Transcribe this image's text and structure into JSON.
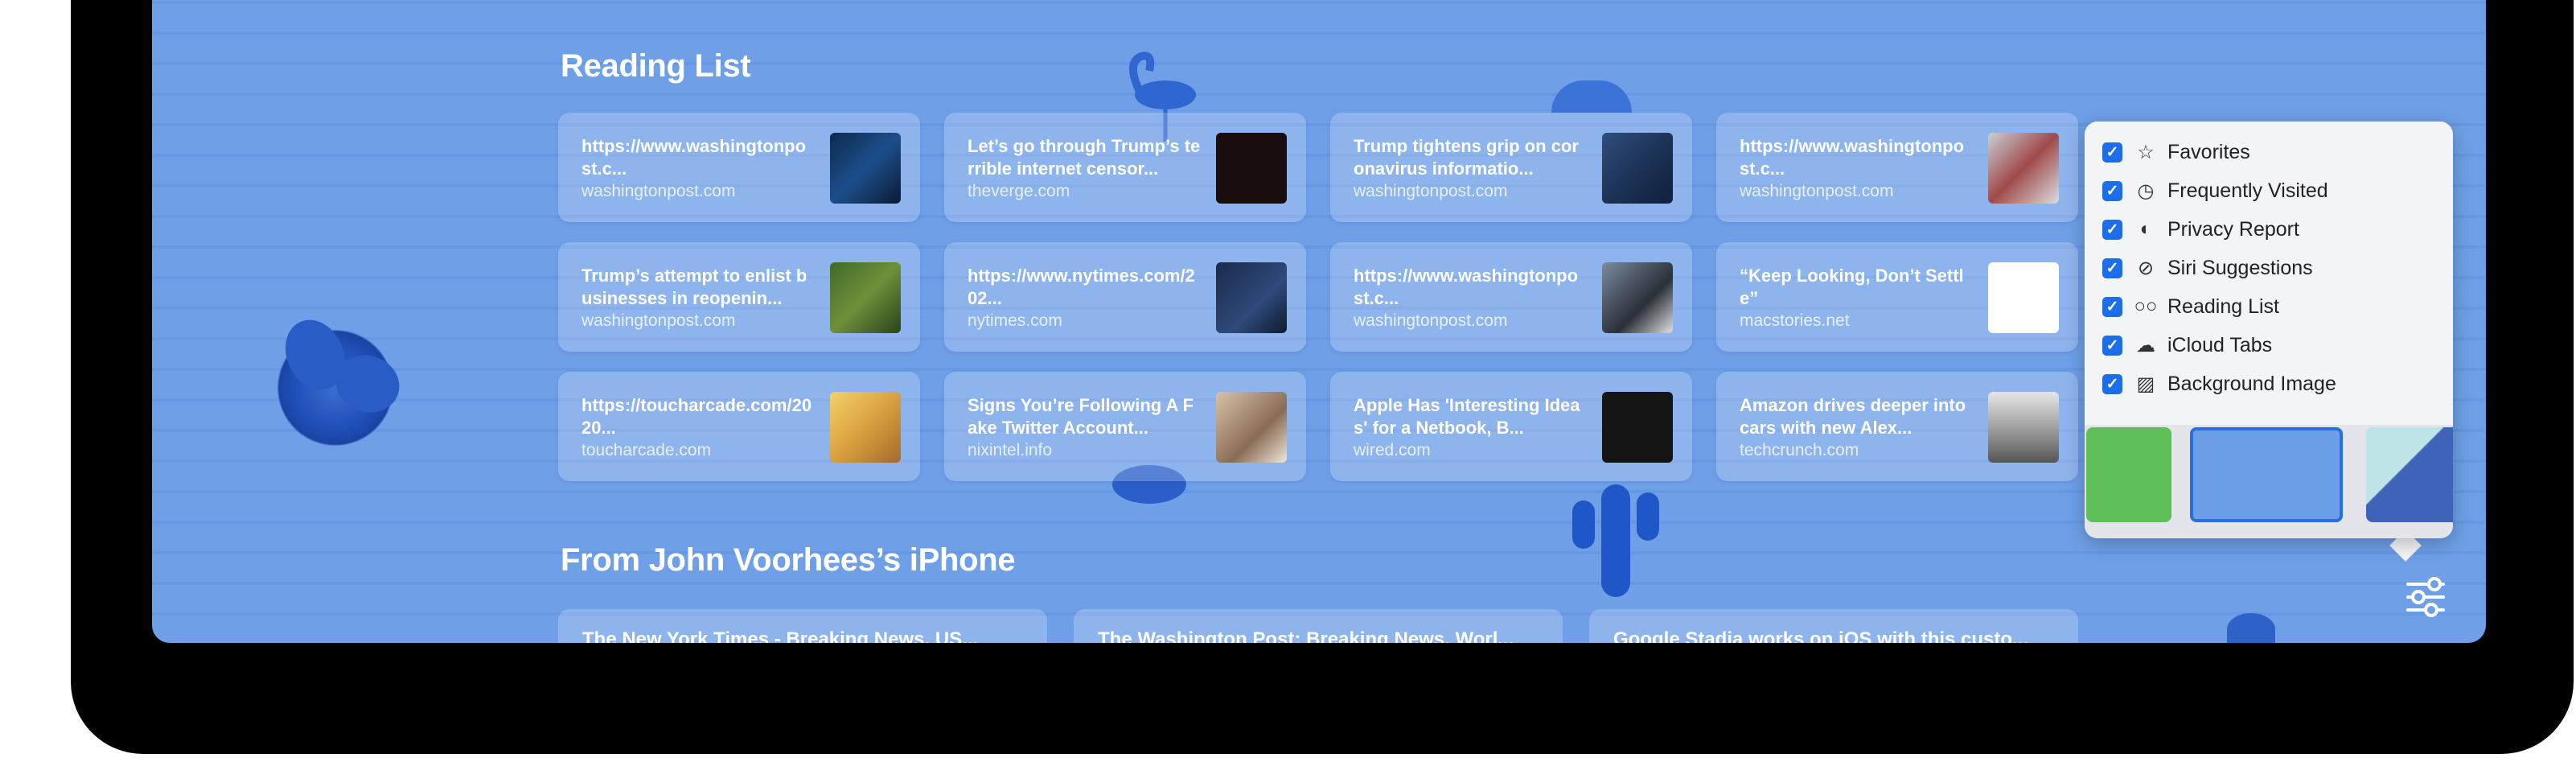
{
  "sections": {
    "reading_list_title": "Reading List",
    "iphone_title": "From John Voorhees’s iPhone"
  },
  "reading_list": [
    {
      "title": "https://www.washingtonpost.c...",
      "domain": "washingtonpost.com",
      "thumb": "tv-studio-image"
    },
    {
      "title": "Let’s go through Trump’s terrible internet censor...",
      "domain": "theverge.com",
      "thumb": "globe-illustration"
    },
    {
      "title": "Trump tightens grip on coronavirus informatio...",
      "domain": "washingtonpost.com",
      "thumb": "press-photo"
    },
    {
      "title": "https://www.washingtonpost.c...",
      "domain": "washingtonpost.com",
      "thumb": "street-photo"
    },
    {
      "title": "Trump’s attempt to enlist businesses in reopenin...",
      "domain": "washingtonpost.com",
      "thumb": "outdoor-photo"
    },
    {
      "title": "https://www.nytimes.com/202...",
      "domain": "nytimes.com",
      "thumb": "meeting-photo"
    },
    {
      "title": "https://www.washingtonpost.c...",
      "domain": "washingtonpost.com",
      "thumb": "portrait-photo"
    },
    {
      "title": "“Keep Looking, Don’t Settle”",
      "domain": "macstories.net",
      "thumb": "bookmark-logo"
    },
    {
      "title": "https://toucharcade.com/2020...",
      "domain": "toucharcade.com",
      "thumb": "game-art"
    },
    {
      "title": "Signs You’re Following A Fake Twitter Account...",
      "domain": "nixintel.info",
      "thumb": "headshot-photo"
    },
    {
      "title": "Apple Has 'Interesting Ideas' for a Netbook, B...",
      "domain": "wired.com",
      "thumb": "stripes-art"
    },
    {
      "title": "Amazon drives deeper into cars with new Alex...",
      "domain": "techcrunch.com",
      "thumb": "car-dashboard-photo"
    }
  ],
  "iphone_tabs": [
    {
      "title": "The New York Times - Breaking News, US..."
    },
    {
      "title": "The Washington Post: Breaking News, Worl..."
    },
    {
      "title": "Google Stadia works on iOS with this custo..."
    }
  ],
  "customize_menu": {
    "options": [
      {
        "label": "Favorites",
        "icon": "star-icon",
        "glyph": "☆",
        "checked": true
      },
      {
        "label": "Frequently Visited",
        "icon": "clock-icon",
        "glyph": "◷",
        "checked": true
      },
      {
        "label": "Privacy Report",
        "icon": "shield-icon",
        "glyph": "◐",
        "checked": true
      },
      {
        "label": "Siri Suggestions",
        "icon": "compass-icon",
        "glyph": "⊘",
        "checked": true
      },
      {
        "label": "Reading List",
        "icon": "glasses-icon",
        "glyph": "○○",
        "checked": true
      },
      {
        "label": "iCloud Tabs",
        "icon": "cloud-icon",
        "glyph": "☁",
        "checked": true
      },
      {
        "label": "Background Image",
        "icon": "image-icon",
        "glyph": "▨",
        "checked": true
      }
    ],
    "check_glyph": "✓",
    "backgrounds": [
      "green-cactus",
      "blue-cactus",
      "teal-geometric"
    ],
    "selected_background": "blue-cactus"
  },
  "colors": {
    "background": "#6e9fe7",
    "accent": "#1c6fe8"
  }
}
